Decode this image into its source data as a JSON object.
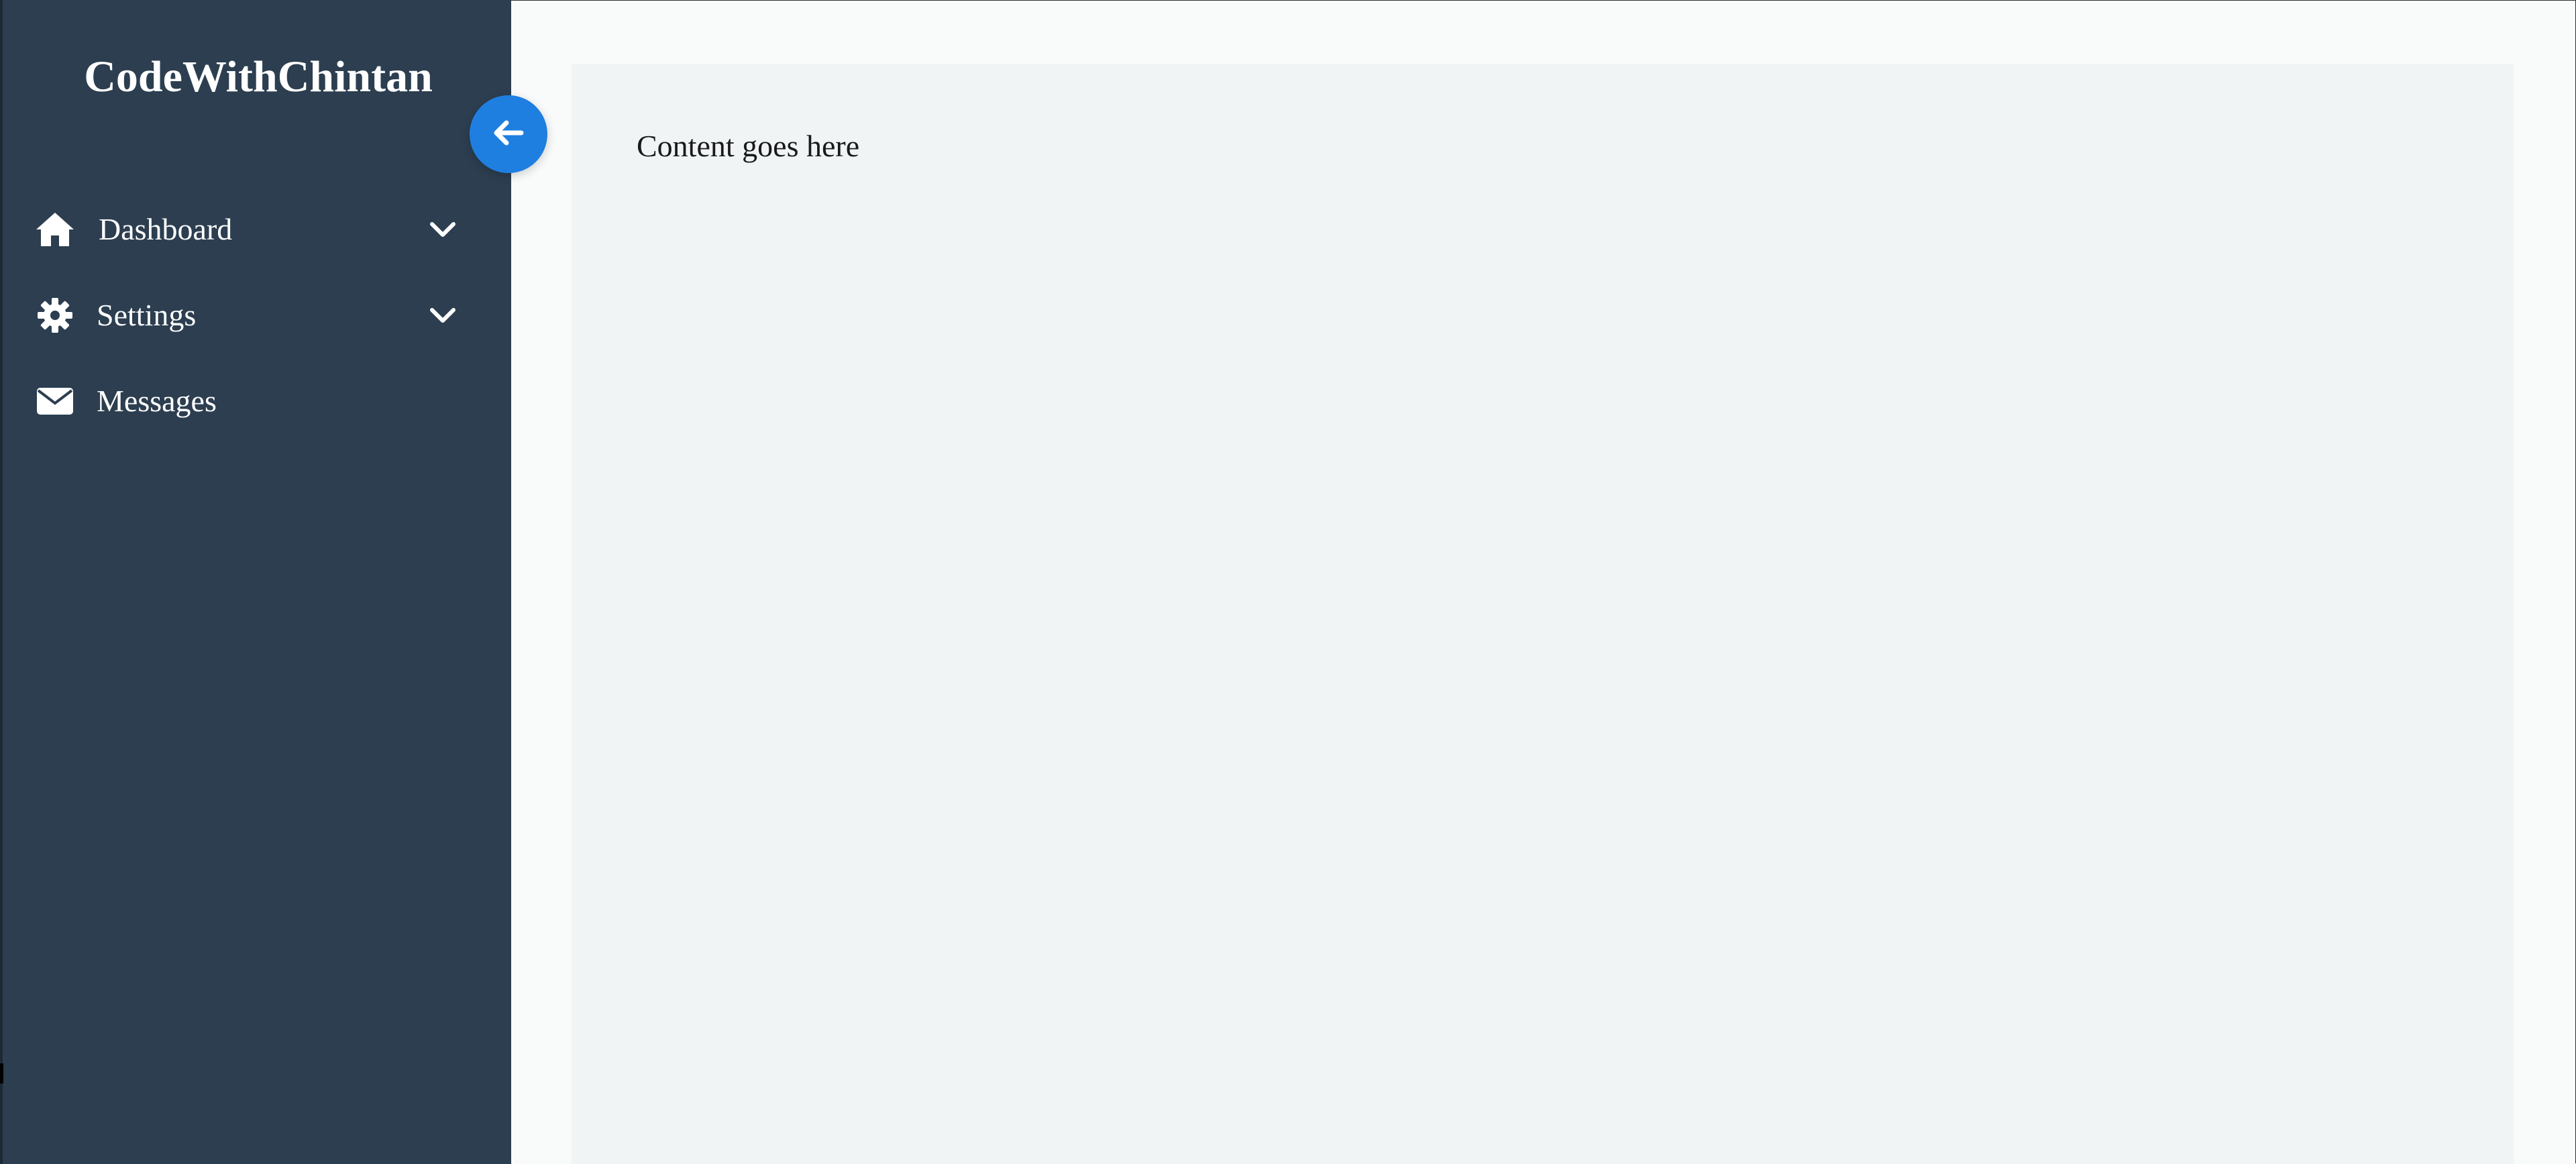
{
  "brand": {
    "title": "CodeWithChintan"
  },
  "sidebar": {
    "toggle": {
      "icon": "arrow-left-icon",
      "color": "#1e7fe0"
    },
    "background": "#2c3e50",
    "items": [
      {
        "label": "Dashboard",
        "icon": "home-icon",
        "has_submenu": true,
        "submenu_icon": "chevron-down-icon"
      },
      {
        "label": "Settings",
        "icon": "gear-icon",
        "has_submenu": true,
        "submenu_icon": "chevron-down-icon"
      },
      {
        "label": "Messages",
        "icon": "envelope-icon",
        "has_submenu": false
      }
    ]
  },
  "main": {
    "content_text": "Content goes here",
    "panel_color": "#f0f4f4"
  }
}
